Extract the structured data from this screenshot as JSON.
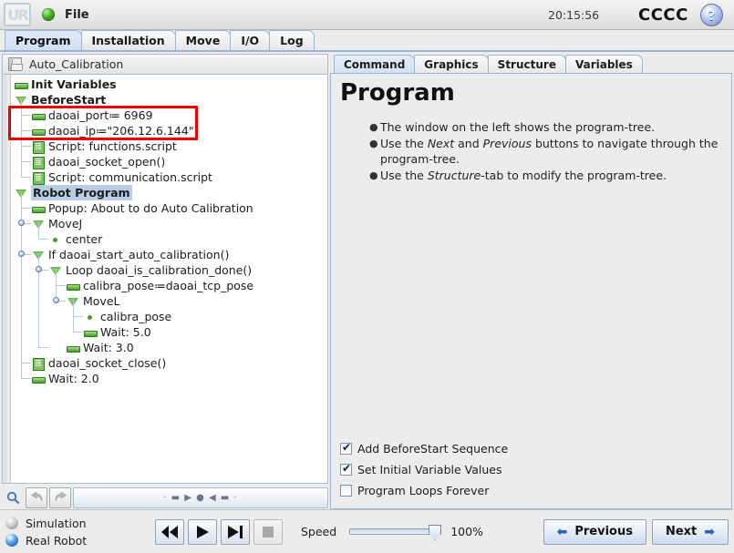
{
  "titlebar": {
    "file_label": "File",
    "clock": "20:15:56",
    "robot_name": "CCCC",
    "help_label": "?",
    "logo_text": "UR",
    "icons": {
      "status_orb": "green-orb-icon",
      "logo": "ur-logo-icon",
      "help": "help-circle-icon"
    }
  },
  "tabs": [
    {
      "label": "Program",
      "active": true
    },
    {
      "label": "Installation",
      "active": false
    },
    {
      "label": "Move",
      "active": false
    },
    {
      "label": "I/O",
      "active": false
    },
    {
      "label": "Log",
      "active": false
    }
  ],
  "program": {
    "file_name": "Auto_Calibration",
    "tree": [
      {
        "label": "Init Variables",
        "indent": 0,
        "icon": "bar",
        "bold": true,
        "selected": false
      },
      {
        "label": "BeforeStart",
        "indent": 0,
        "icon": "tri",
        "bold": true,
        "selected": false
      },
      {
        "label": "daoai_port≔ 6969",
        "indent": 1,
        "icon": "bar",
        "bold": false,
        "selected": false
      },
      {
        "label": "daoai_ip≔\"206.12.6.144\"",
        "indent": 1,
        "icon": "bar",
        "bold": false,
        "selected": false
      },
      {
        "label": "Script: functions.script",
        "indent": 1,
        "icon": "script",
        "bold": false,
        "selected": false
      },
      {
        "label": "daoai_socket_open()",
        "indent": 1,
        "icon": "script",
        "bold": false,
        "selected": false
      },
      {
        "label": "Script: communication.script",
        "indent": 1,
        "icon": "script",
        "bold": false,
        "selected": false
      },
      {
        "label": "Robot Program",
        "indent": 0,
        "icon": "tri",
        "bold": true,
        "selected": true
      },
      {
        "label": "Popup: About to do Auto Calibration",
        "indent": 1,
        "icon": "bar",
        "bold": false,
        "selected": false
      },
      {
        "label": "MoveJ",
        "indent": 1,
        "icon": "tri",
        "bold": false,
        "selected": false
      },
      {
        "label": "center",
        "indent": 2,
        "icon": "dot",
        "bold": false,
        "selected": false
      },
      {
        "label": "If daoai_start_auto_calibration()",
        "indent": 1,
        "icon": "tri",
        "bold": false,
        "selected": false
      },
      {
        "label": "Loop daoai_is_calibration_done()",
        "indent": 2,
        "icon": "tri",
        "bold": false,
        "selected": false
      },
      {
        "label": "calibra_pose≔daoai_tcp_pose",
        "indent": 3,
        "icon": "bar",
        "bold": false,
        "selected": false
      },
      {
        "label": "MoveL",
        "indent": 3,
        "icon": "tri",
        "bold": false,
        "selected": false
      },
      {
        "label": "calibra_pose",
        "indent": 4,
        "icon": "dot",
        "bold": false,
        "selected": false
      },
      {
        "label": "Wait: 5.0",
        "indent": 4,
        "icon": "bar",
        "bold": false,
        "selected": false
      },
      {
        "label": "Wait: 3.0",
        "indent": 3,
        "icon": "bar",
        "bold": false,
        "selected": false
      },
      {
        "label": "daoai_socket_close()",
        "indent": 1,
        "icon": "script",
        "bold": false,
        "selected": false
      },
      {
        "label": "Wait: 2.0",
        "indent": 1,
        "icon": "bar",
        "bold": false,
        "selected": false
      }
    ],
    "highlight": {
      "color": "#f20000",
      "note": "red annotation box around daoai_port and daoai_ip rows"
    },
    "toolbar": {
      "search_icon": "search-icon",
      "undo_icon": "undo-arrow-icon",
      "redo_icon": "redo-arrow-icon",
      "divider_glyph": "· ▬ ▶ ● ◀ ▬ ·"
    }
  },
  "right": {
    "tabs": [
      {
        "label": "Command",
        "active": true
      },
      {
        "label": "Graphics",
        "active": false
      },
      {
        "label": "Structure",
        "active": false
      },
      {
        "label": "Variables",
        "active": false
      }
    ],
    "title": "Program",
    "bullets": [
      {
        "parts": [
          {
            "text": "The window on the left shows the program-tree.",
            "italic": false
          }
        ]
      },
      {
        "parts": [
          {
            "text": "Use the ",
            "italic": false
          },
          {
            "text": "Next",
            "italic": true
          },
          {
            "text": " and ",
            "italic": false
          },
          {
            "text": "Previous",
            "italic": true
          },
          {
            "text": " buttons to navigate through the program-tree.",
            "italic": false
          }
        ]
      },
      {
        "parts": [
          {
            "text": "Use the ",
            "italic": false
          },
          {
            "text": "Structure",
            "italic": true
          },
          {
            "text": "-tab to modify the program-tree.",
            "italic": false
          }
        ]
      }
    ],
    "checkboxes": [
      {
        "label": "Add BeforeStart Sequence",
        "checked": true
      },
      {
        "label": "Set Initial Variable Values",
        "checked": true
      },
      {
        "label": "Program Loops Forever",
        "checked": false
      }
    ]
  },
  "bottom": {
    "modes": [
      {
        "label": "Simulation",
        "selected": false
      },
      {
        "label": "Real Robot",
        "selected": true
      }
    ],
    "transport": [
      {
        "name": "rewind-button",
        "glyph": "rewind",
        "disabled": false
      },
      {
        "name": "play-button",
        "glyph": "play",
        "disabled": false
      },
      {
        "name": "step-button",
        "glyph": "step",
        "disabled": false
      },
      {
        "name": "stop-button",
        "glyph": "stop",
        "disabled": true
      }
    ],
    "speed_label": "Speed",
    "speed_value": "100%",
    "speed_percent": 100,
    "previous_label": "Previous",
    "next_label": "Next"
  }
}
